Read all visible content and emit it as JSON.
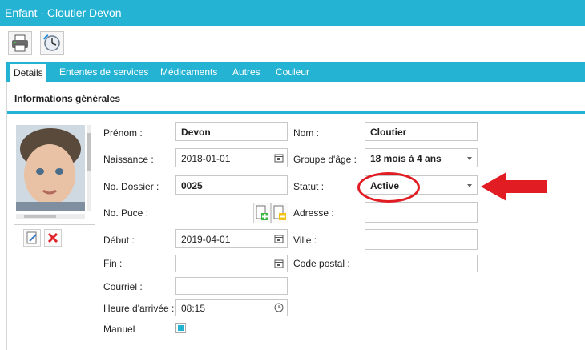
{
  "window": {
    "title": "Enfant - Cloutier Devon"
  },
  "toolbar": {
    "print_icon": "printer-icon",
    "history_icon": "clock-icon"
  },
  "tabs": [
    {
      "label": "Details"
    },
    {
      "label": "Ententes de services"
    },
    {
      "label": "Médicaments"
    },
    {
      "label": "Autres"
    },
    {
      "label": "Couleur"
    }
  ],
  "section": {
    "title": "Informations générales"
  },
  "form": {
    "prenom_label": "Prénom :",
    "prenom_value": "Devon",
    "nom_label": "Nom :",
    "nom_value": "Cloutier",
    "naissance_label": "Naissance :",
    "naissance_value": "2018-01-01",
    "groupe_label": "Groupe d'âge :",
    "groupe_value": "18 mois à 4 ans",
    "dossier_label": "No. Dossier :",
    "dossier_value": "0025",
    "statut_label": "Statut :",
    "statut_value": "Active",
    "puce_label": "No. Puce :",
    "adresse_label": "Adresse :",
    "adresse_value": "",
    "debut_label": "Début :",
    "debut_value": "2019-04-01",
    "ville_label": "Ville :",
    "ville_value": "",
    "fin_label": "Fin :",
    "fin_value": "",
    "code_label": "Code postal :",
    "code_value": "",
    "courriel_label": "Courriel :",
    "courriel_value": "",
    "heure_label": "Heure d'arrivée :",
    "heure_value": "08:15",
    "manuel_label": "Manuel",
    "manuel_checked": true
  },
  "colors": {
    "accent": "#25b3d3",
    "annotation": "#e21c23"
  }
}
